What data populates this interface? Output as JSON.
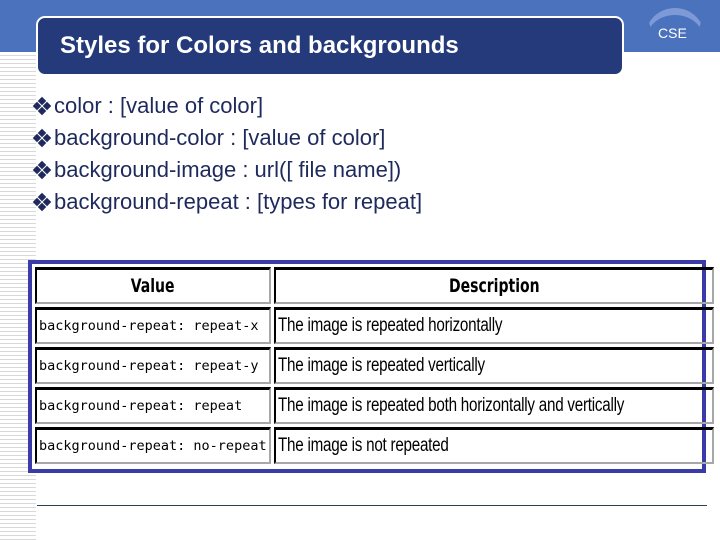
{
  "slide": {
    "title": "Styles for Colors and backgrounds",
    "logo_text": "CSE",
    "colors": {
      "top_band": "#4a72bd",
      "title_box": "#243a7a",
      "bullet_text": "#1f2a5c",
      "table_frame": "#3a3aa8"
    }
  },
  "bullets": [
    {
      "icon": "diamond-cluster-icon",
      "text": "color : [value of color]"
    },
    {
      "icon": "diamond-cluster-icon",
      "text": "background-color : [value of color]"
    },
    {
      "icon": "diamond-cluster-icon",
      "text": "background-image : url([ file name])"
    },
    {
      "icon": "diamond-cluster-icon",
      "text": "background-repeat : [types for repeat]"
    }
  ],
  "table": {
    "headers": [
      "Value",
      "Description"
    ],
    "rows": [
      [
        "background-repeat: repeat-x",
        "The image is repeated horizontally"
      ],
      [
        "background-repeat: repeat-y",
        "The image is repeated vertically"
      ],
      [
        "background-repeat: repeat",
        "The image is repeated both horizontally and vertically"
      ],
      [
        "background-repeat: no-repeat",
        "The image is not repeated"
      ]
    ]
  }
}
